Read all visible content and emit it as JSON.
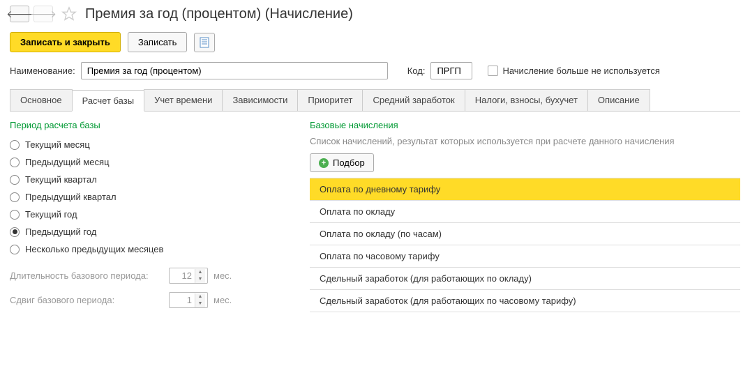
{
  "header": {
    "title": "Премия за год (процентом) (Начисление)"
  },
  "toolbar": {
    "save_close": "Записать и закрыть",
    "save": "Записать"
  },
  "form": {
    "name_label": "Наименование:",
    "name_value": "Премия за год (процентом)",
    "code_label": "Код:",
    "code_value": "ПРГП",
    "disabled_label": "Начисление больше не используется"
  },
  "tabs": [
    "Основное",
    "Расчет базы",
    "Учет времени",
    "Зависимости",
    "Приоритет",
    "Средний заработок",
    "Налоги, взносы, бухучет",
    "Описание"
  ],
  "active_tab": 1,
  "left": {
    "section_title": "Период расчета базы",
    "radios": [
      "Текущий месяц",
      "Предыдущий месяц",
      "Текущий квартал",
      "Предыдущий квартал",
      "Текущий год",
      "Предыдущий год",
      "Несколько предыдущих месяцев"
    ],
    "radio_checked": 5,
    "duration_label": "Длительность базового периода:",
    "duration_value": "12",
    "shift_label": "Сдвиг базового периода:",
    "shift_value": "1",
    "unit": "мес."
  },
  "right": {
    "section_title": "Базовые начисления",
    "hint": "Список начислений, результат которых используется при расчете данного начисления",
    "pick_label": "Подбор",
    "items": [
      "Оплата по дневному тарифу",
      "Оплата по окладу",
      "Оплата по окладу (по часам)",
      "Оплата по часовому тарифу",
      "Сдельный заработок (для работающих по окладу)",
      "Сдельный заработок (для работающих по часовому тарифу)"
    ],
    "selected": 0
  }
}
